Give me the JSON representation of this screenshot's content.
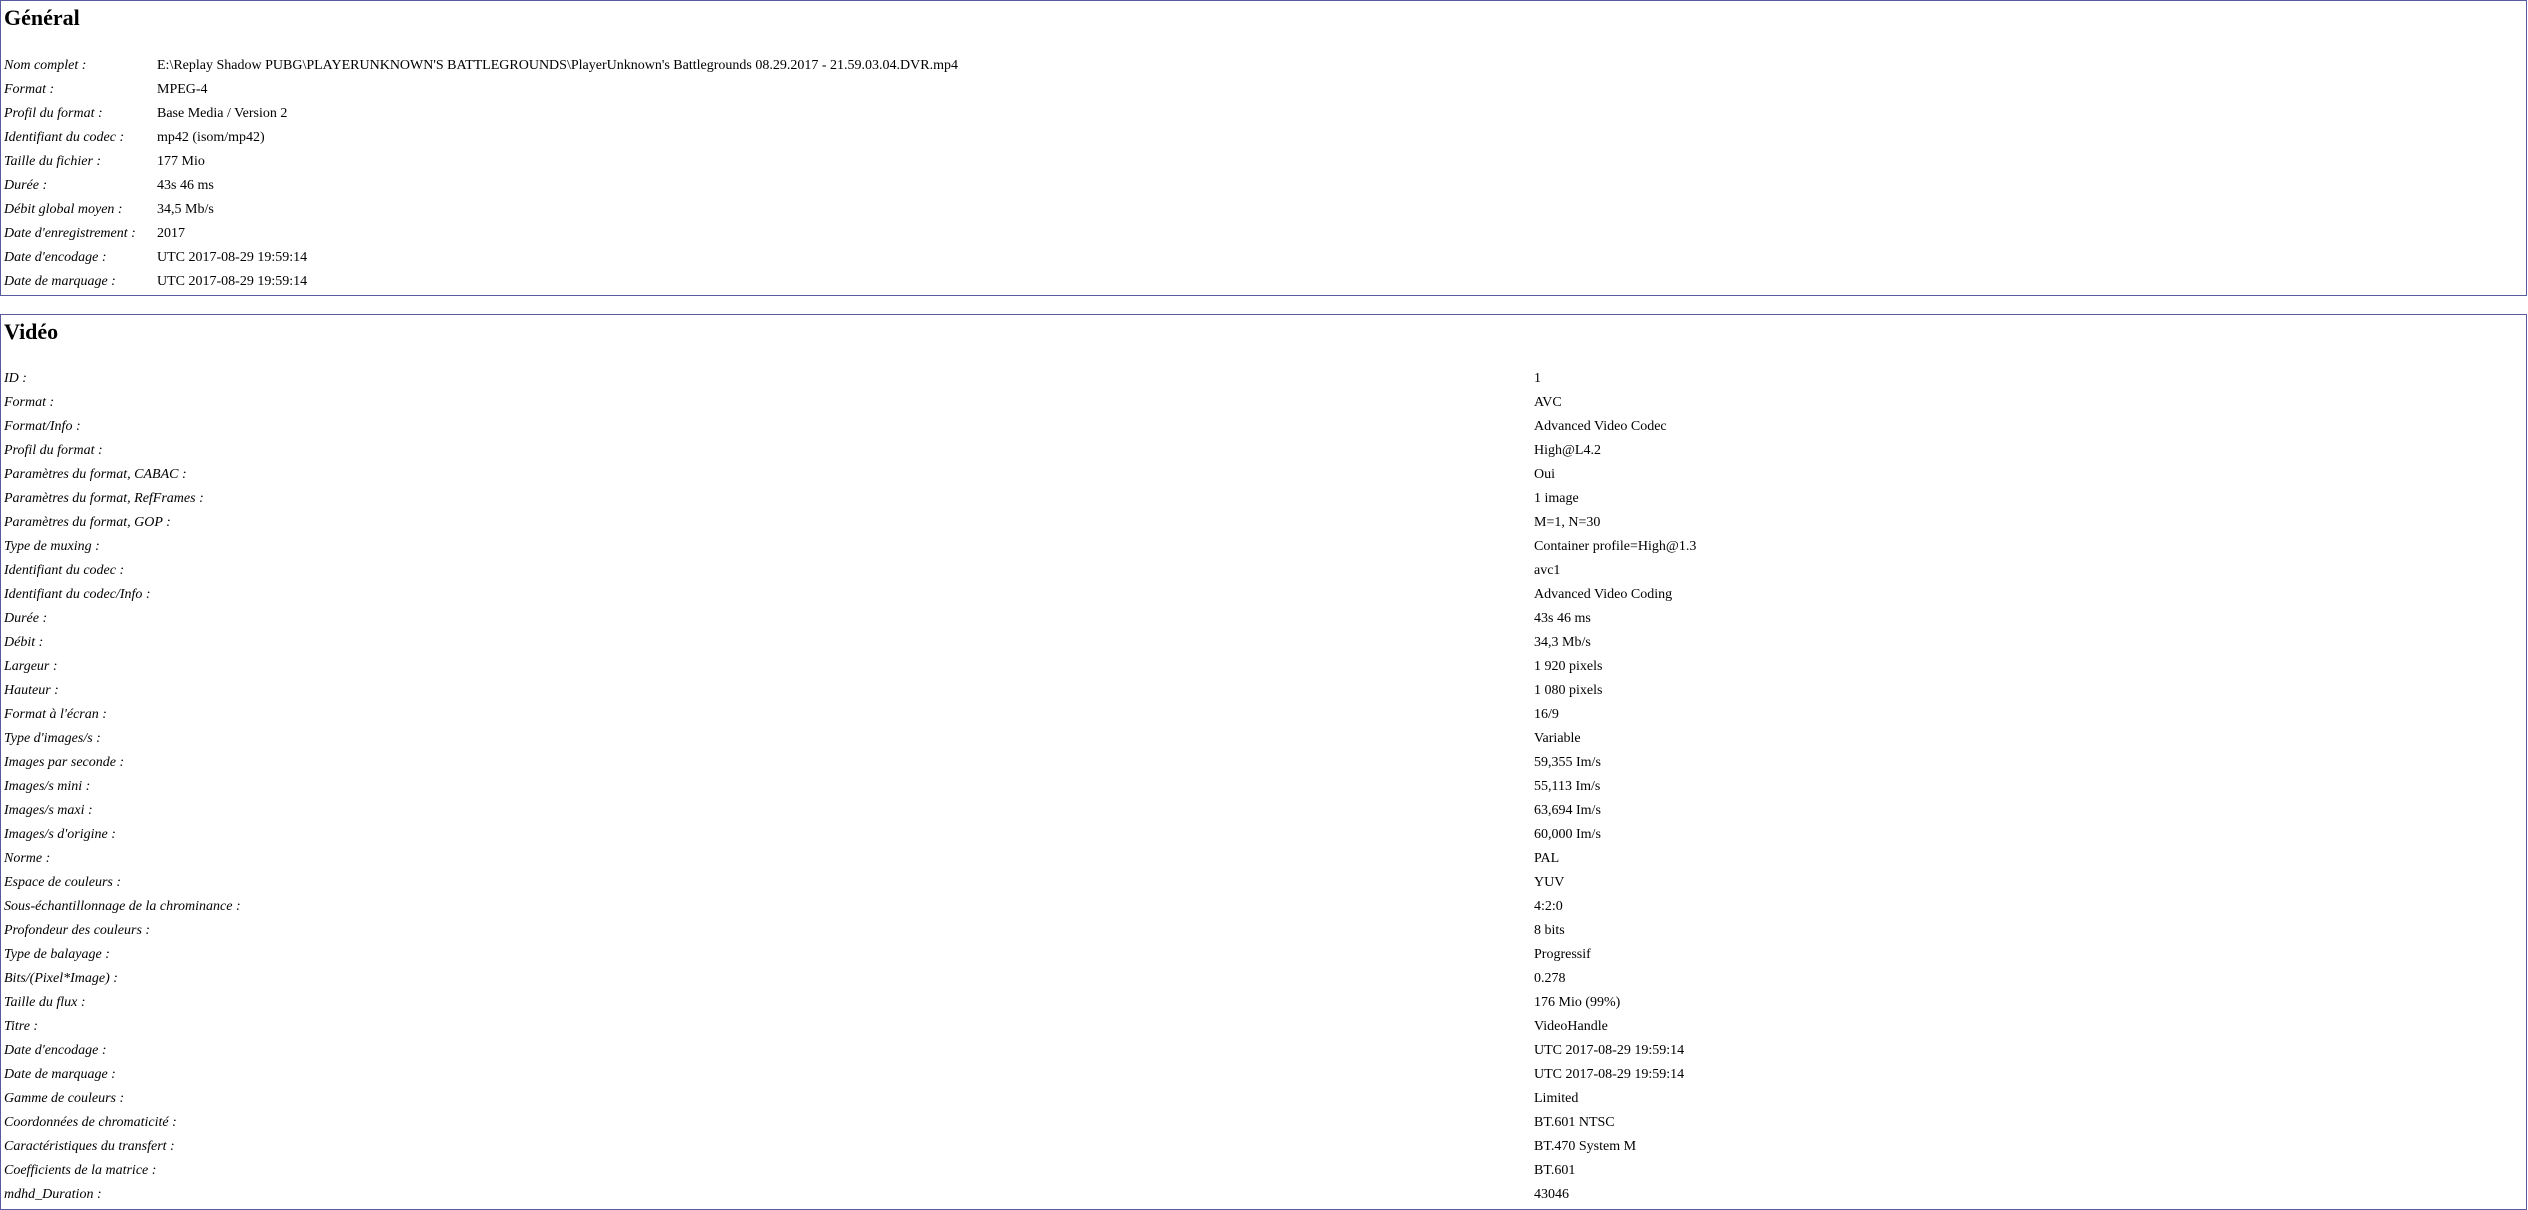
{
  "general": {
    "title": "Général",
    "rows": [
      {
        "key": "Nom complet :",
        "value": "E:\\Replay Shadow PUBG\\PLAYERUNKNOWN'S BATTLEGROUNDS\\PlayerUnknown's Battlegrounds 08.29.2017 - 21.59.03.04.DVR.mp4"
      },
      {
        "key": "Format :",
        "value": "MPEG-4"
      },
      {
        "key": "Profil du format :",
        "value": "Base Media / Version 2"
      },
      {
        "key": "Identifiant du codec :",
        "value": "mp42 (isom/mp42)"
      },
      {
        "key": "Taille du fichier :",
        "value": "177 Mio"
      },
      {
        "key": "Durée :",
        "value": "43s 46 ms"
      },
      {
        "key": "Débit global moyen :",
        "value": "34,5 Mb/s"
      },
      {
        "key": "Date d'enregistrement :",
        "value": "2017"
      },
      {
        "key": "Date d'encodage :",
        "value": "UTC 2017-08-29 19:59:14"
      },
      {
        "key": "Date de marquage :",
        "value": "UTC 2017-08-29 19:59:14"
      }
    ]
  },
  "video": {
    "title": "Vidéo",
    "rows": [
      {
        "key": "ID :",
        "value": "1"
      },
      {
        "key": "Format :",
        "value": "AVC"
      },
      {
        "key": "Format/Info :",
        "value": "Advanced Video Codec"
      },
      {
        "key": "Profil du format :",
        "value": "High@L4.2"
      },
      {
        "key": "Paramètres du format, CABAC :",
        "value": "Oui"
      },
      {
        "key": "Paramètres du format, RefFrames :",
        "value": "1 image"
      },
      {
        "key": "Paramètres du format, GOP :",
        "value": "M=1, N=30"
      },
      {
        "key": "Type de muxing :",
        "value": "Container profile=High@1.3"
      },
      {
        "key": "Identifiant du codec :",
        "value": "avc1"
      },
      {
        "key": "Identifiant du codec/Info :",
        "value": "Advanced Video Coding"
      },
      {
        "key": "Durée :",
        "value": "43s 46 ms"
      },
      {
        "key": "Débit :",
        "value": "34,3 Mb/s"
      },
      {
        "key": "Largeur :",
        "value": "1 920 pixels"
      },
      {
        "key": "Hauteur :",
        "value": "1 080 pixels"
      },
      {
        "key": "Format à l'écran :",
        "value": "16/9"
      },
      {
        "key": "Type d'images/s :",
        "value": "Variable"
      },
      {
        "key": "Images par seconde :",
        "value": "59,355 Im/s"
      },
      {
        "key": "Images/s mini :",
        "value": "55,113 Im/s"
      },
      {
        "key": "Images/s maxi :",
        "value": "63,694 Im/s"
      },
      {
        "key": "Images/s d'origine :",
        "value": "60,000 Im/s"
      },
      {
        "key": "Norme :",
        "value": "PAL"
      },
      {
        "key": "Espace de couleurs :",
        "value": "YUV"
      },
      {
        "key": "Sous-échantillonnage de la chrominance :",
        "value": "4:2:0"
      },
      {
        "key": "Profondeur des couleurs :",
        "value": "8 bits"
      },
      {
        "key": "Type de balayage :",
        "value": "Progressif"
      },
      {
        "key": "Bits/(Pixel*Image) :",
        "value": "0.278"
      },
      {
        "key": "Taille du flux :",
        "value": "176 Mio (99%)"
      },
      {
        "key": "Titre :",
        "value": "VideoHandle"
      },
      {
        "key": "Date d'encodage :",
        "value": "UTC 2017-08-29 19:59:14"
      },
      {
        "key": "Date de marquage :",
        "value": "UTC 2017-08-29 19:59:14"
      },
      {
        "key": "Gamme de couleurs :",
        "value": "Limited"
      },
      {
        "key": "Coordonnées de chromaticité :",
        "value": "BT.601 NTSC"
      },
      {
        "key": "Caractéristiques du transfert :",
        "value": "BT.470 System M"
      },
      {
        "key": "Coefficients de la matrice :",
        "value": "BT.601"
      },
      {
        "key": "mdhd_Duration :",
        "value": "43046"
      }
    ]
  }
}
